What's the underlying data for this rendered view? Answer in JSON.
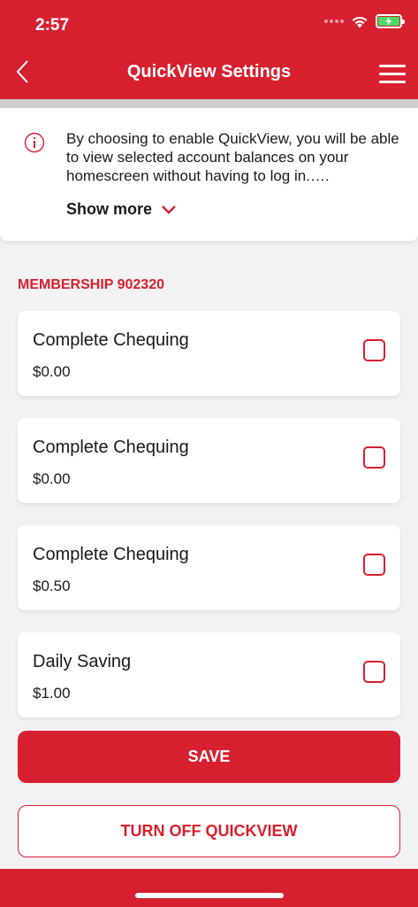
{
  "status_bar": {
    "time": "2:57"
  },
  "header": {
    "title": "QuickView Settings"
  },
  "info": {
    "text": "By choosing to enable QuickView, you will be able to view selected account balances on your homescreen without having to log in.….",
    "show_more": "Show more"
  },
  "membership": {
    "label": "MEMBERSHIP 902320"
  },
  "accounts": [
    {
      "name": "Complete Chequing",
      "balance": "$0.00",
      "checked": false
    },
    {
      "name": "Complete Chequing",
      "balance": "$0.00",
      "checked": false
    },
    {
      "name": "Complete Chequing",
      "balance": "$0.50",
      "checked": false
    },
    {
      "name": "Daily Saving",
      "balance": "$1.00",
      "checked": false
    }
  ],
  "buttons": {
    "save": "SAVE",
    "turn_off": "TURN OFF QUICKVIEW"
  },
  "icons": [
    "wifi-icon",
    "battery-icon",
    "back-icon",
    "menu-icon",
    "info-icon",
    "chevron-down-icon"
  ],
  "colors": {
    "brand": "#d7202f",
    "background": "#f2f2f2",
    "card": "#ffffff",
    "battery": "#4cd964"
  }
}
